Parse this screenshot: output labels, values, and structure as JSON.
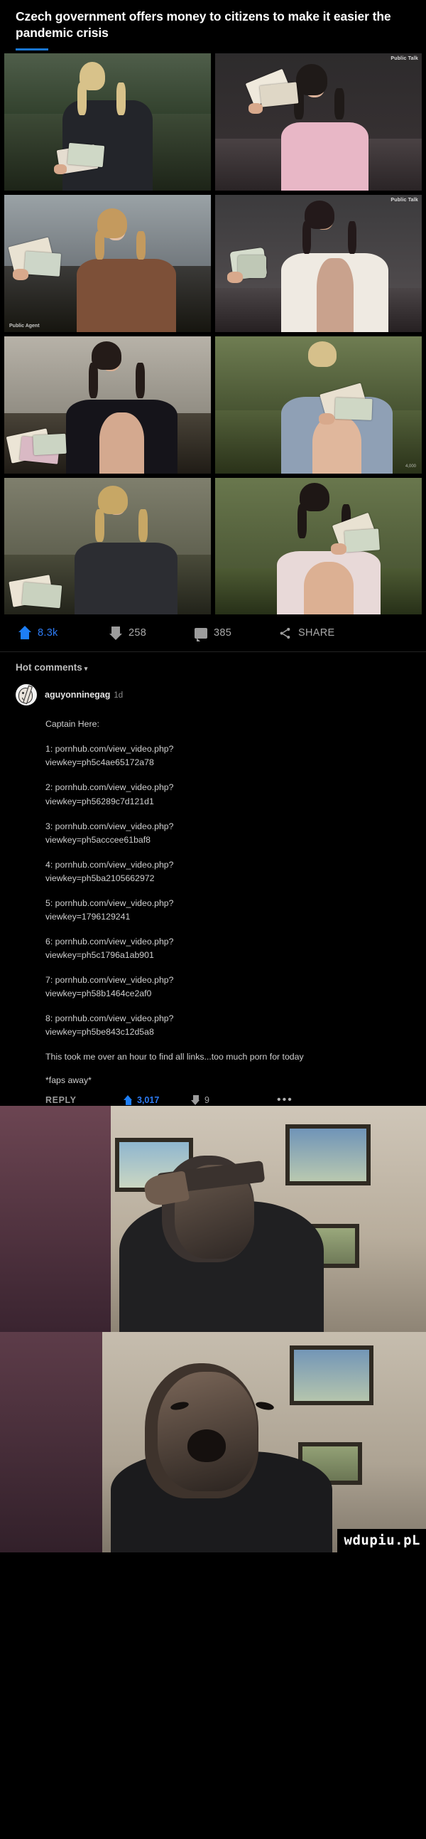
{
  "post": {
    "title": "Czech government offers money to citizens to make it easier the pandemic crisis",
    "accent_color": "#1976d2",
    "media": {
      "count": 8,
      "tiles": [
        {
          "watermark_top": "",
          "watermark_bottom": "",
          "description": "blonde woman outdoors holding banknotes"
        },
        {
          "watermark_top": "Public Talk",
          "watermark_bottom": "",
          "description": "dark haired woman indoors with cash fan"
        },
        {
          "watermark_top": "",
          "watermark_bottom": "Public Agent",
          "description": "woman in brown coat with money"
        },
        {
          "watermark_top": "Public Talk",
          "watermark_bottom": "",
          "description": "woman in white jacket holding a roll of bills"
        },
        {
          "watermark_top": "",
          "watermark_bottom": "",
          "description": "brunette holding spread of banknotes"
        },
        {
          "watermark_top": "",
          "watermark_bottom": "4,000",
          "description": "woman outdoors holding folded money"
        },
        {
          "watermark_top": "",
          "watermark_bottom": "",
          "description": "blonde woman near fence fanning cash"
        },
        {
          "watermark_top": "",
          "watermark_bottom": "",
          "description": "woman in pink top counting bills"
        }
      ]
    }
  },
  "actions": {
    "upvotes": "8.3k",
    "downvotes": "258",
    "comments": "385",
    "share_label": "SHARE",
    "upvote_color": "#2d7bf4"
  },
  "comments_section": {
    "header": "Hot comments",
    "caret": "▾",
    "comment": {
      "username": "aguyonninegag",
      "time": "1d",
      "intro": "Captain Here:",
      "links": [
        {
          "index": "1: pornhub.com/view_video.php?",
          "viewkey": "viewkey=ph5c4ae65172a78"
        },
        {
          "index": "2: pornhub.com/view_video.php?",
          "viewkey": "viewkey=ph56289c7d121d1"
        },
        {
          "index": "3: pornhub.com/view_video.php?",
          "viewkey": "viewkey=ph5acccee61baf8"
        },
        {
          "index": "4: pornhub.com/view_video.php?",
          "viewkey": "viewkey=ph5ba2105662972"
        },
        {
          "index": "5: pornhub.com/view_video.php?",
          "viewkey": "viewkey=1796129241"
        },
        {
          "index": "6: pornhub.com/view_video.php?",
          "viewkey": "viewkey=ph5c1796a1ab901"
        },
        {
          "index": "7: pornhub.com/view_video.php?",
          "viewkey": "viewkey=ph58b1464ce2af0"
        },
        {
          "index": "8: pornhub.com/view_video.php?",
          "viewkey": "viewkey=ph5be843c12d5a8"
        }
      ],
      "outro": "This took me over an hour to find all links...too much porn for today",
      "signoff": "*faps away*",
      "reply_label": "REPLY",
      "reply_upvotes": "3,017",
      "reply_downvotes": "9",
      "more_label": "•••"
    }
  },
  "reactions": [
    {
      "description": "man saluting with hand to forehead in front of paintings"
    },
    {
      "description": "same man screaming, distorted close-up"
    }
  ],
  "watermark": "wdupiu.pL"
}
